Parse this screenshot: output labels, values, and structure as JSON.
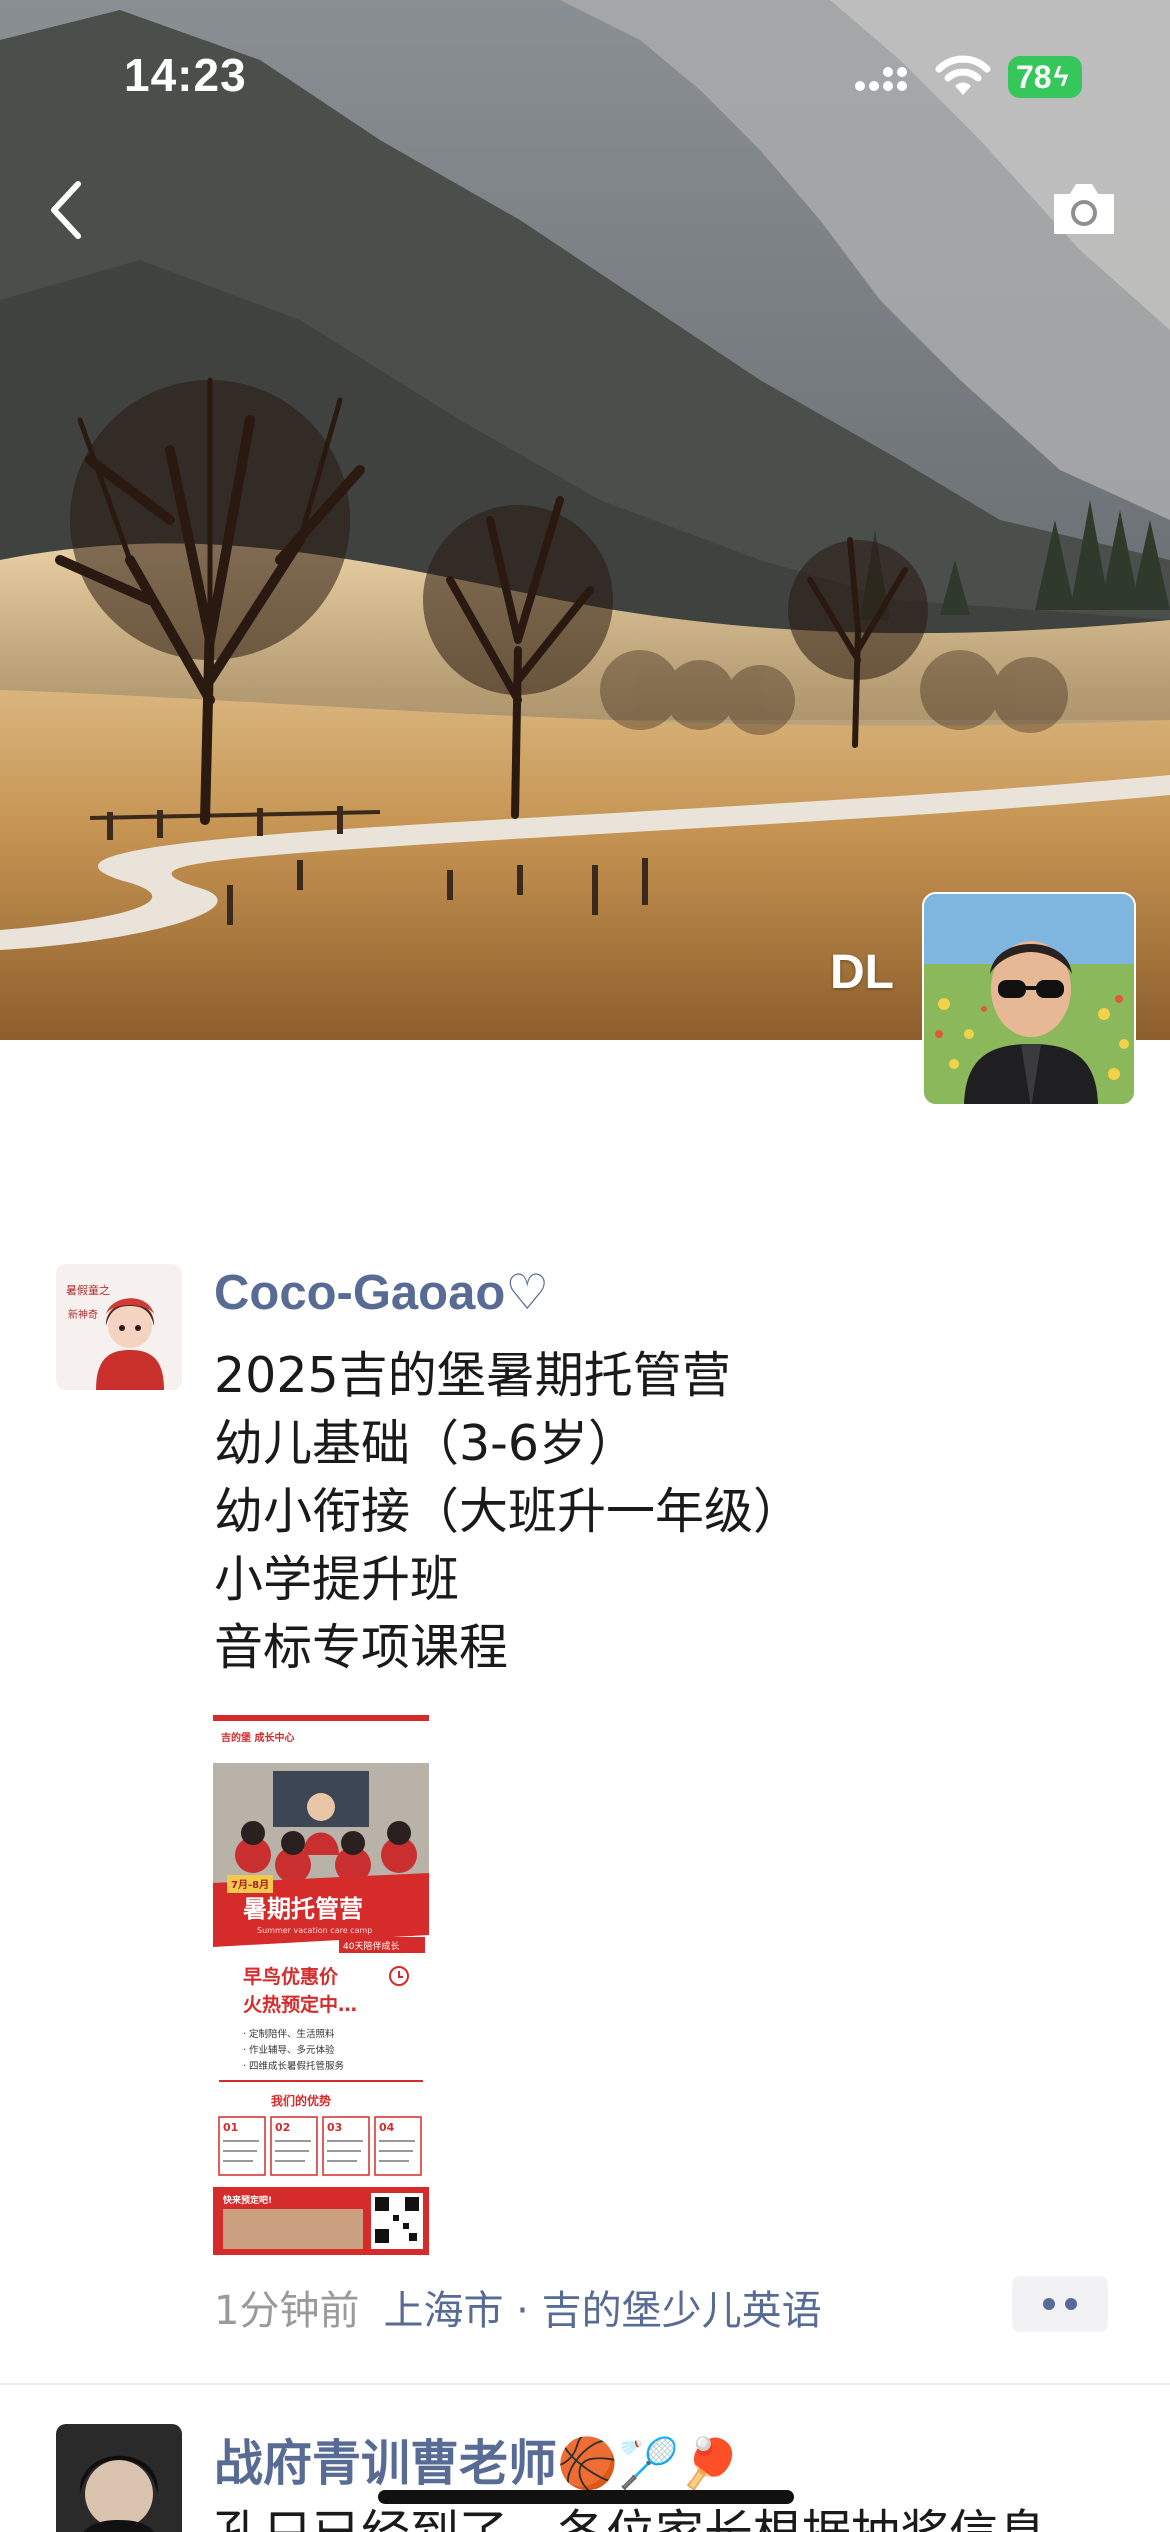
{
  "status_bar": {
    "time": "14:23",
    "battery": "78",
    "signal_icon": "cellular-signal-icon",
    "wifi_icon": "wifi-icon",
    "battery_color": "#35c759"
  },
  "header": {
    "back_icon": "chevron-left-icon",
    "camera_icon": "camera-icon",
    "cover_name": "DL"
  },
  "posts": [
    {
      "author": "Coco-Gaoao",
      "author_suffix": "♡",
      "lines": [
        "2025吉的堡暑期托管营",
        "幼儿基础（3-6岁）",
        "幼小衔接（大班升一年级）",
        "小学提升班",
        "音标专项课程"
      ],
      "poster": {
        "brand": "吉的堡 成长中心",
        "date_ribbon": "7月-8月",
        "title": "暑期托管营",
        "subtitle": "Summer vacation care camp",
        "tag": "40天陪伴成长",
        "promo_1": "早鸟优惠价",
        "promo_2": "火热预定中…",
        "bullets": [
          "· 定制陪伴、生活照料",
          "· 作业辅导、多元体验",
          "· 四维成长暑假托管服务"
        ],
        "advantages_title": "我们的优势",
        "advantage_numbers": [
          "01",
          "02",
          "03",
          "04"
        ],
        "footer": "快来预定吧!"
      },
      "time_ago": "1分钟前",
      "location": "上海市 · 吉的堡少儿英语"
    },
    {
      "author": "战府青训曹老师🏀🏸🏓",
      "lines": [
        "孔只已经到了，各位家长根据抽奖信息"
      ]
    }
  ],
  "colors": {
    "link_blue": "#576b95",
    "meta_gray": "#9a9a9a",
    "poster_red": "#d62b2b"
  }
}
